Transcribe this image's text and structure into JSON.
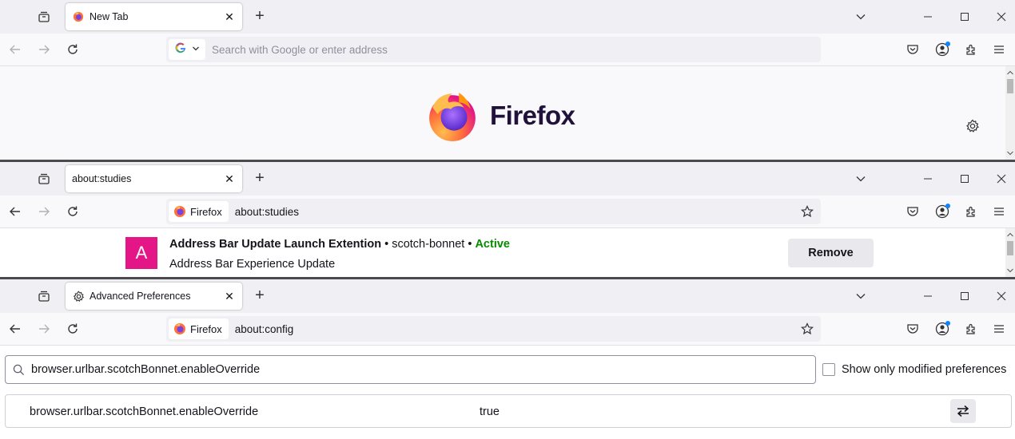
{
  "window1": {
    "tab": {
      "title": "New Tab"
    },
    "urlbar": {
      "placeholder": "Search with Google or enter address"
    },
    "newtab": {
      "wordmark": "Firefox"
    }
  },
  "window2": {
    "tab": {
      "title": "about:studies"
    },
    "urlbar": {
      "identity_label": "Firefox",
      "url": "about:studies"
    },
    "study": {
      "icon_letter": "A",
      "name": "Address Bar Update Launch Extention",
      "separator": " • ",
      "slug": "scotch-bonnet",
      "status": "Active",
      "description": "Address Bar Experience Update",
      "remove_label": "Remove"
    }
  },
  "window3": {
    "tab": {
      "title": "Advanced Preferences"
    },
    "urlbar": {
      "identity_label": "Firefox",
      "url": "about:config"
    },
    "search": {
      "value": "browser.urlbar.scotchBonnet.enableOverride"
    },
    "show_modified_label": "Show only modified preferences",
    "pref": {
      "name": "browser.urlbar.scotchBonnet.enableOverride",
      "value": "true"
    }
  },
  "colors": {
    "study_icon": "#e31587",
    "active_status": "#058b00",
    "account_badge": "#0a84ff"
  },
  "icons": {
    "tab_list": "tab-list-icon",
    "new_tab": "plus-icon",
    "all_tabs": "chevron-down-icon",
    "back": "back-arrow-icon",
    "forward": "forward-arrow-icon",
    "reload": "reload-icon",
    "pocket": "pocket-icon",
    "account": "account-icon",
    "extensions": "puzzle-icon",
    "menu": "hamburger-menu-icon"
  }
}
